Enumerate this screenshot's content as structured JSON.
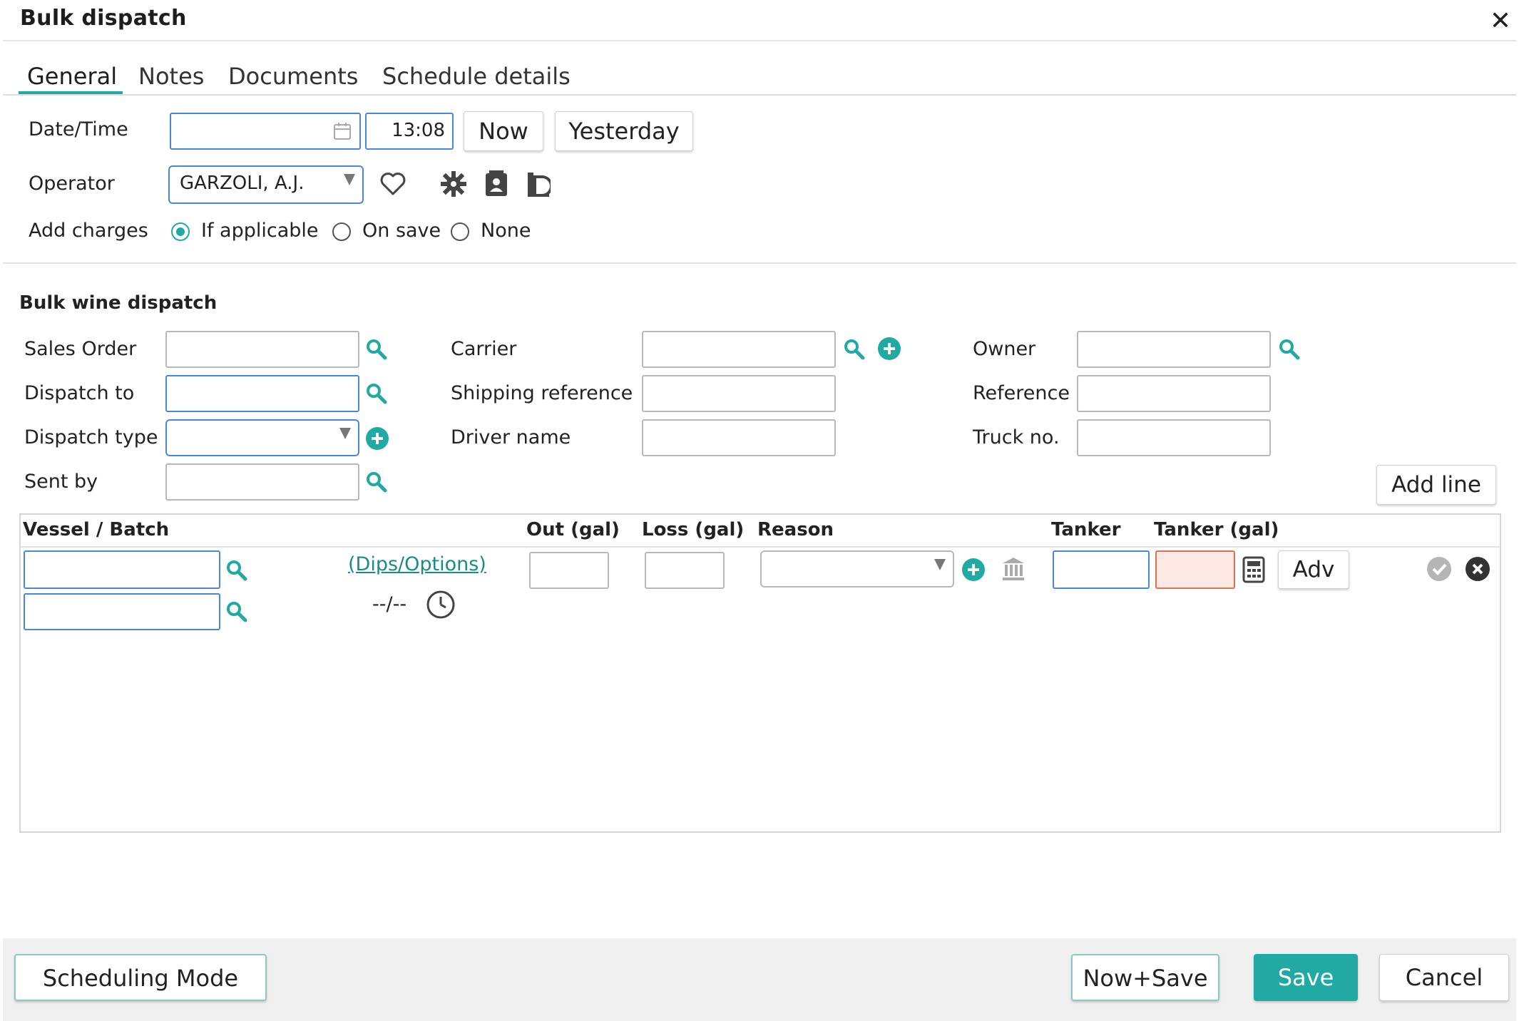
{
  "window": {
    "title": "Bulk dispatch"
  },
  "tabs": [
    {
      "label": "General"
    },
    {
      "label": "Notes"
    },
    {
      "label": "Documents"
    },
    {
      "label": "Schedule details"
    }
  ],
  "general": {
    "datetime_label": "Date/Time",
    "date_value": "",
    "time_value": "13:08",
    "now_label": "Now",
    "yesterday_label": "Yesterday",
    "operator_label": "Operator",
    "operator_value": "GARZOLI, A.J.",
    "charges_label": "Add charges",
    "charges_options": [
      "If applicable",
      "On save",
      "None"
    ],
    "charges_selected": "If applicable"
  },
  "dispatch": {
    "section_title": "Bulk wine dispatch",
    "sales_order_label": "Sales Order",
    "dispatch_to_label": "Dispatch to",
    "dispatch_type_label": "Dispatch type",
    "sent_by_label": "Sent by",
    "carrier_label": "Carrier",
    "shipping_ref_label": "Shipping reference",
    "driver_label": "Driver name",
    "owner_label": "Owner",
    "reference_label": "Reference",
    "truck_label": "Truck no.",
    "add_line_label": "Add line"
  },
  "grid": {
    "headers": {
      "vessel": "Vessel / Batch",
      "out": "Out (gal)",
      "loss": "Loss (gal)",
      "reason": "Reason",
      "tanker": "Tanker",
      "tanker_gal": "Tanker (gal)"
    },
    "row": {
      "dips_link": "(Dips/Options)",
      "date_placeholder": "--/--",
      "adv_label": "Adv"
    }
  },
  "footer": {
    "scheduling_label": "Scheduling Mode",
    "now_save_label": "Now+Save",
    "save_label": "Save",
    "cancel_label": "Cancel"
  },
  "colors": {
    "accent": "#21a9a4",
    "field_border_active": "#4a86d9",
    "error_fill": "#fde8e4"
  }
}
